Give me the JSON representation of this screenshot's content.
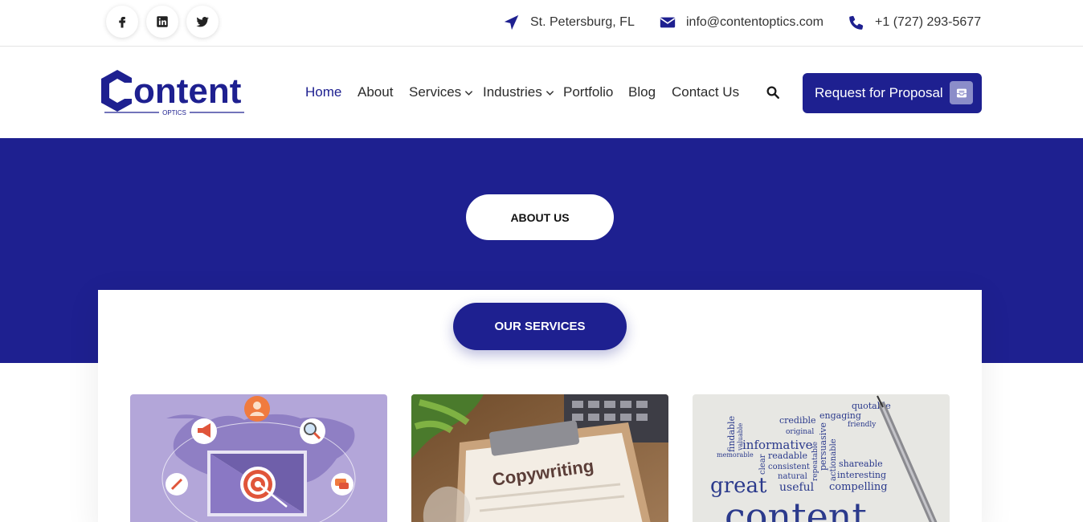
{
  "topbar": {
    "social": [
      {
        "name": "facebook-icon"
      },
      {
        "name": "linkedin-icon"
      },
      {
        "name": "twitter-icon"
      }
    ],
    "location": "St. Petersburg, FL",
    "email": "info@contentoptics.com",
    "phone": "+1 (727) 293-5677"
  },
  "brand": {
    "name": "Content",
    "tagline": "OPTICS",
    "color": "#1e2090"
  },
  "nav": {
    "items": [
      {
        "label": "Home",
        "active": true
      },
      {
        "label": "About"
      },
      {
        "label": "Services",
        "dropdown": true
      },
      {
        "label": "Industries",
        "dropdown": true
      },
      {
        "label": "Portfolio"
      },
      {
        "label": "Blog"
      },
      {
        "label": "Contact Us"
      }
    ],
    "cta": "Request for Proposal"
  },
  "hero": {
    "badge": "ABOUT US"
  },
  "services": {
    "badge": "OUR SERVICES",
    "cards": [
      {
        "image": "digital-marketing-illustration"
      },
      {
        "image": "copywriting-photo",
        "text": "Copywriting"
      },
      {
        "image": "content-word-cloud",
        "words": [
          "quotable",
          "credible",
          "engaging",
          "findable",
          "original",
          "friendly",
          "valuable",
          "informative",
          "persuasive",
          "memorable",
          "readable",
          "consistent",
          "shareable",
          "natural",
          "interesting",
          "great",
          "useful",
          "compelling",
          "content",
          "clear",
          "actionable",
          "repeatable"
        ]
      }
    ]
  }
}
